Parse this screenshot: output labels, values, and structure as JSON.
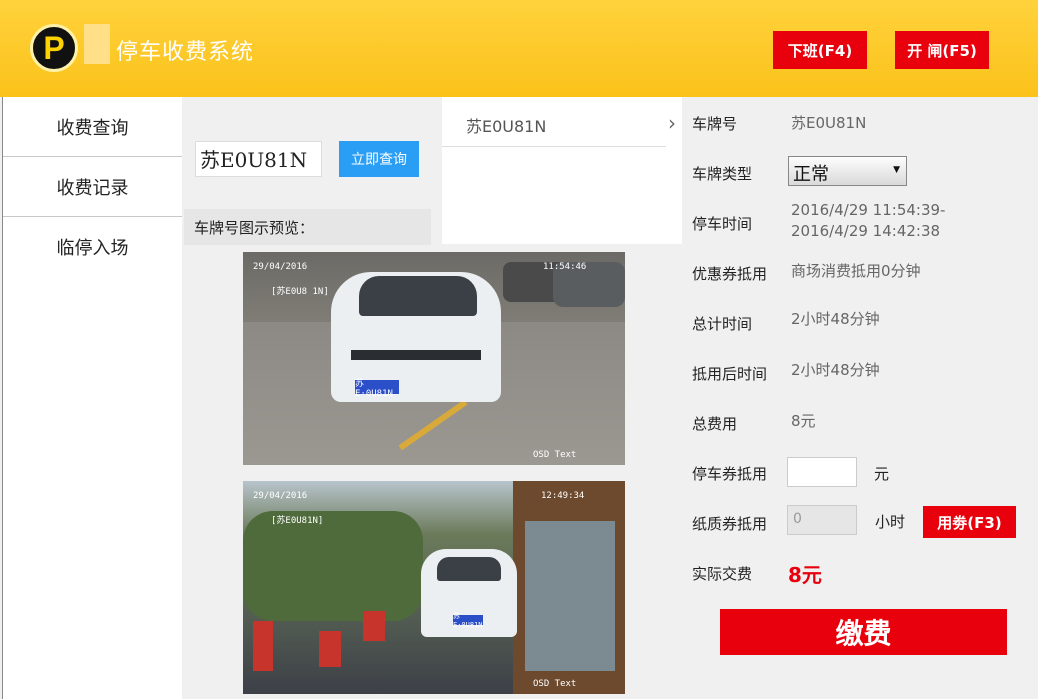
{
  "header": {
    "logo_letter": "P",
    "title": "停车收费系统",
    "off_duty_label": "下班(F4)",
    "open_gate_label": "开 闸(F5)",
    "accent_color": "#fbc21a",
    "button_color": "#e8000c"
  },
  "sidebar": {
    "items": [
      {
        "label": "收费查询"
      },
      {
        "label": "收费记录"
      },
      {
        "label": "临停入场"
      }
    ]
  },
  "search": {
    "plate_value": "苏E0U81N",
    "query_label": "立即查询",
    "preview_label": "车牌号图示预览："
  },
  "results": {
    "items": [
      {
        "plate": "苏E0U81N"
      }
    ]
  },
  "photos": {
    "entry": {
      "date": "29/04/2016",
      "time": "11:54:46",
      "plate_tag": "[苏E0U8 1N]",
      "plate": "苏E·0U81N",
      "osd": "OSD   Text"
    },
    "exit": {
      "date": "29/04/2016",
      "time": "12:49:34",
      "plate_tag": "[苏E0U81N]",
      "plate": "苏E·0U81N",
      "osd": "OSD   Text"
    }
  },
  "detail": {
    "plate_label": "车牌号",
    "plate_value": "苏E0U81N",
    "plate_type_label": "车牌类型",
    "plate_type_value": "正常",
    "park_time_label": "停车时间",
    "park_time_value_1": "2016/4/29 11:54:39-",
    "park_time_value_2": "2016/4/29 14:42:38",
    "coupon_label": "优惠券抵用",
    "coupon_value": "商场消费抵用0分钟",
    "total_time_label": "总计时间",
    "total_time_value": "2小时48分钟",
    "after_time_label": "抵用后时间",
    "after_time_value": "2小时48分钟",
    "total_fee_label": "总费用",
    "total_fee_value": "8元",
    "parking_coupon_label": "停车券抵用",
    "parking_coupon_value": "",
    "parking_coupon_unit": "元",
    "paper_coupon_label": "纸质券抵用",
    "paper_coupon_value": "0",
    "paper_coupon_unit": "小时",
    "use_coupon_label": "用劵(F3)",
    "actual_fee_label": "实际交费",
    "actual_fee_value": "8元",
    "pay_label": "缴费"
  }
}
